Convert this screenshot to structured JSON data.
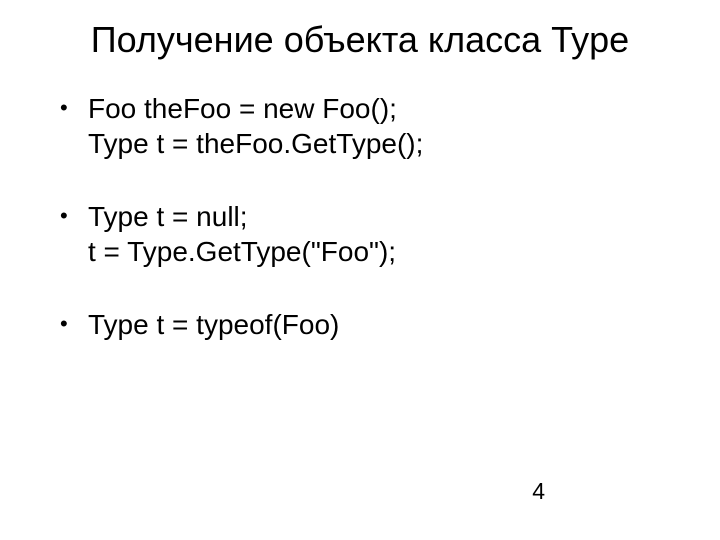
{
  "title": "Получение объекта класса Type",
  "bullets": [
    {
      "lines": [
        "Foo theFoo = new Foo();",
        "Type t = theFoo.GetType();"
      ]
    },
    {
      "lines": [
        "Type t = null;",
        "t = Type.GetType(\"Foo\");"
      ]
    },
    {
      "lines": [
        "Type t = typeof(Foo)"
      ]
    }
  ],
  "page_number": "4"
}
